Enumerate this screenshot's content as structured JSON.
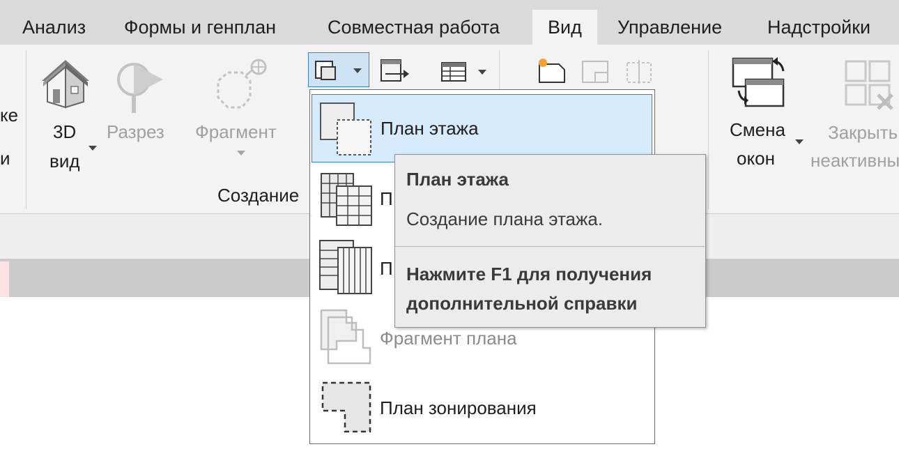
{
  "ribbon_tabs": [
    {
      "label": "Анализ"
    },
    {
      "label": "Формы и генплан"
    },
    {
      "label": "Совместная работа"
    },
    {
      "label": "Вид"
    },
    {
      "label": "Управление"
    },
    {
      "label": "Надстройки"
    }
  ],
  "active_tab": "Вид",
  "ribbon": {
    "left_cut_line1": "ке",
    "left_cut_line2": "и",
    "btn_3d_line1": "3D",
    "btn_3d_line2": "вид",
    "btn_section": "Разрез",
    "btn_callout": "Фрагмент",
    "panel_create_label": "Создание",
    "btn_switch_line1": "Смена",
    "btn_switch_line2": "окон",
    "btn_close_line1": "Закрыть",
    "btn_close_line2": "неактивные"
  },
  "dropdown": {
    "items": [
      {
        "label": "План этажа",
        "icon": "floor-plan-icon"
      },
      {
        "label": "П",
        "icon": "reflected-ceiling-plan-icon"
      },
      {
        "label": "П",
        "icon": "structural-plan-icon"
      },
      {
        "label": "Фрагмент плана",
        "icon": "plan-region-icon"
      },
      {
        "label": "План зонирования",
        "icon": "area-plan-icon"
      }
    ]
  },
  "tooltip": {
    "title": "План этажа",
    "description": "Создание плана этажа.",
    "help": "Нажмите F1 для получения дополнительной справки"
  },
  "colors": {
    "accent_border": "#3c7fc1",
    "highlight_bg": "#d6ebfb",
    "disabled_text": "#a0a0a0"
  }
}
